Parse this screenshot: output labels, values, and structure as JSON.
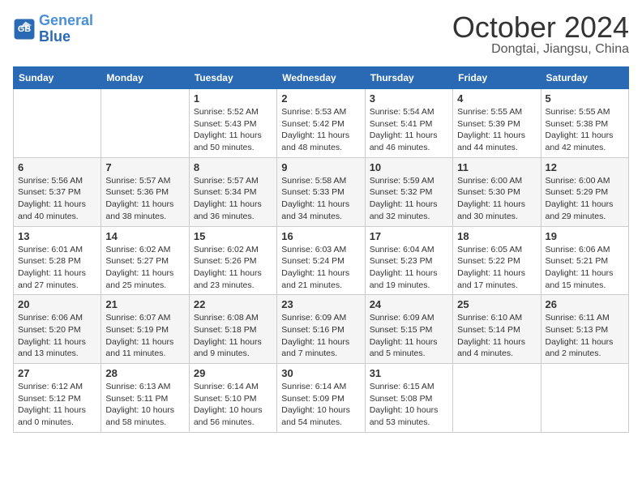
{
  "logo": {
    "line1": "General",
    "line2": "Blue"
  },
  "title": "October 2024",
  "location": "Dongtai, Jiangsu, China",
  "days_header": [
    "Sunday",
    "Monday",
    "Tuesday",
    "Wednesday",
    "Thursday",
    "Friday",
    "Saturday"
  ],
  "weeks": [
    [
      {
        "num": "",
        "info": ""
      },
      {
        "num": "",
        "info": ""
      },
      {
        "num": "1",
        "info": "Sunrise: 5:52 AM\nSunset: 5:43 PM\nDaylight: 11 hours\nand 50 minutes."
      },
      {
        "num": "2",
        "info": "Sunrise: 5:53 AM\nSunset: 5:42 PM\nDaylight: 11 hours\nand 48 minutes."
      },
      {
        "num": "3",
        "info": "Sunrise: 5:54 AM\nSunset: 5:41 PM\nDaylight: 11 hours\nand 46 minutes."
      },
      {
        "num": "4",
        "info": "Sunrise: 5:55 AM\nSunset: 5:39 PM\nDaylight: 11 hours\nand 44 minutes."
      },
      {
        "num": "5",
        "info": "Sunrise: 5:55 AM\nSunset: 5:38 PM\nDaylight: 11 hours\nand 42 minutes."
      }
    ],
    [
      {
        "num": "6",
        "info": "Sunrise: 5:56 AM\nSunset: 5:37 PM\nDaylight: 11 hours\nand 40 minutes."
      },
      {
        "num": "7",
        "info": "Sunrise: 5:57 AM\nSunset: 5:36 PM\nDaylight: 11 hours\nand 38 minutes."
      },
      {
        "num": "8",
        "info": "Sunrise: 5:57 AM\nSunset: 5:34 PM\nDaylight: 11 hours\nand 36 minutes."
      },
      {
        "num": "9",
        "info": "Sunrise: 5:58 AM\nSunset: 5:33 PM\nDaylight: 11 hours\nand 34 minutes."
      },
      {
        "num": "10",
        "info": "Sunrise: 5:59 AM\nSunset: 5:32 PM\nDaylight: 11 hours\nand 32 minutes."
      },
      {
        "num": "11",
        "info": "Sunrise: 6:00 AM\nSunset: 5:30 PM\nDaylight: 11 hours\nand 30 minutes."
      },
      {
        "num": "12",
        "info": "Sunrise: 6:00 AM\nSunset: 5:29 PM\nDaylight: 11 hours\nand 29 minutes."
      }
    ],
    [
      {
        "num": "13",
        "info": "Sunrise: 6:01 AM\nSunset: 5:28 PM\nDaylight: 11 hours\nand 27 minutes."
      },
      {
        "num": "14",
        "info": "Sunrise: 6:02 AM\nSunset: 5:27 PM\nDaylight: 11 hours\nand 25 minutes."
      },
      {
        "num": "15",
        "info": "Sunrise: 6:02 AM\nSunset: 5:26 PM\nDaylight: 11 hours\nand 23 minutes."
      },
      {
        "num": "16",
        "info": "Sunrise: 6:03 AM\nSunset: 5:24 PM\nDaylight: 11 hours\nand 21 minutes."
      },
      {
        "num": "17",
        "info": "Sunrise: 6:04 AM\nSunset: 5:23 PM\nDaylight: 11 hours\nand 19 minutes."
      },
      {
        "num": "18",
        "info": "Sunrise: 6:05 AM\nSunset: 5:22 PM\nDaylight: 11 hours\nand 17 minutes."
      },
      {
        "num": "19",
        "info": "Sunrise: 6:06 AM\nSunset: 5:21 PM\nDaylight: 11 hours\nand 15 minutes."
      }
    ],
    [
      {
        "num": "20",
        "info": "Sunrise: 6:06 AM\nSunset: 5:20 PM\nDaylight: 11 hours\nand 13 minutes."
      },
      {
        "num": "21",
        "info": "Sunrise: 6:07 AM\nSunset: 5:19 PM\nDaylight: 11 hours\nand 11 minutes."
      },
      {
        "num": "22",
        "info": "Sunrise: 6:08 AM\nSunset: 5:18 PM\nDaylight: 11 hours\nand 9 minutes."
      },
      {
        "num": "23",
        "info": "Sunrise: 6:09 AM\nSunset: 5:16 PM\nDaylight: 11 hours\nand 7 minutes."
      },
      {
        "num": "24",
        "info": "Sunrise: 6:09 AM\nSunset: 5:15 PM\nDaylight: 11 hours\nand 5 minutes."
      },
      {
        "num": "25",
        "info": "Sunrise: 6:10 AM\nSunset: 5:14 PM\nDaylight: 11 hours\nand 4 minutes."
      },
      {
        "num": "26",
        "info": "Sunrise: 6:11 AM\nSunset: 5:13 PM\nDaylight: 11 hours\nand 2 minutes."
      }
    ],
    [
      {
        "num": "27",
        "info": "Sunrise: 6:12 AM\nSunset: 5:12 PM\nDaylight: 11 hours\nand 0 minutes."
      },
      {
        "num": "28",
        "info": "Sunrise: 6:13 AM\nSunset: 5:11 PM\nDaylight: 10 hours\nand 58 minutes."
      },
      {
        "num": "29",
        "info": "Sunrise: 6:14 AM\nSunset: 5:10 PM\nDaylight: 10 hours\nand 56 minutes."
      },
      {
        "num": "30",
        "info": "Sunrise: 6:14 AM\nSunset: 5:09 PM\nDaylight: 10 hours\nand 54 minutes."
      },
      {
        "num": "31",
        "info": "Sunrise: 6:15 AM\nSunset: 5:08 PM\nDaylight: 10 hours\nand 53 minutes."
      },
      {
        "num": "",
        "info": ""
      },
      {
        "num": "",
        "info": ""
      }
    ]
  ]
}
